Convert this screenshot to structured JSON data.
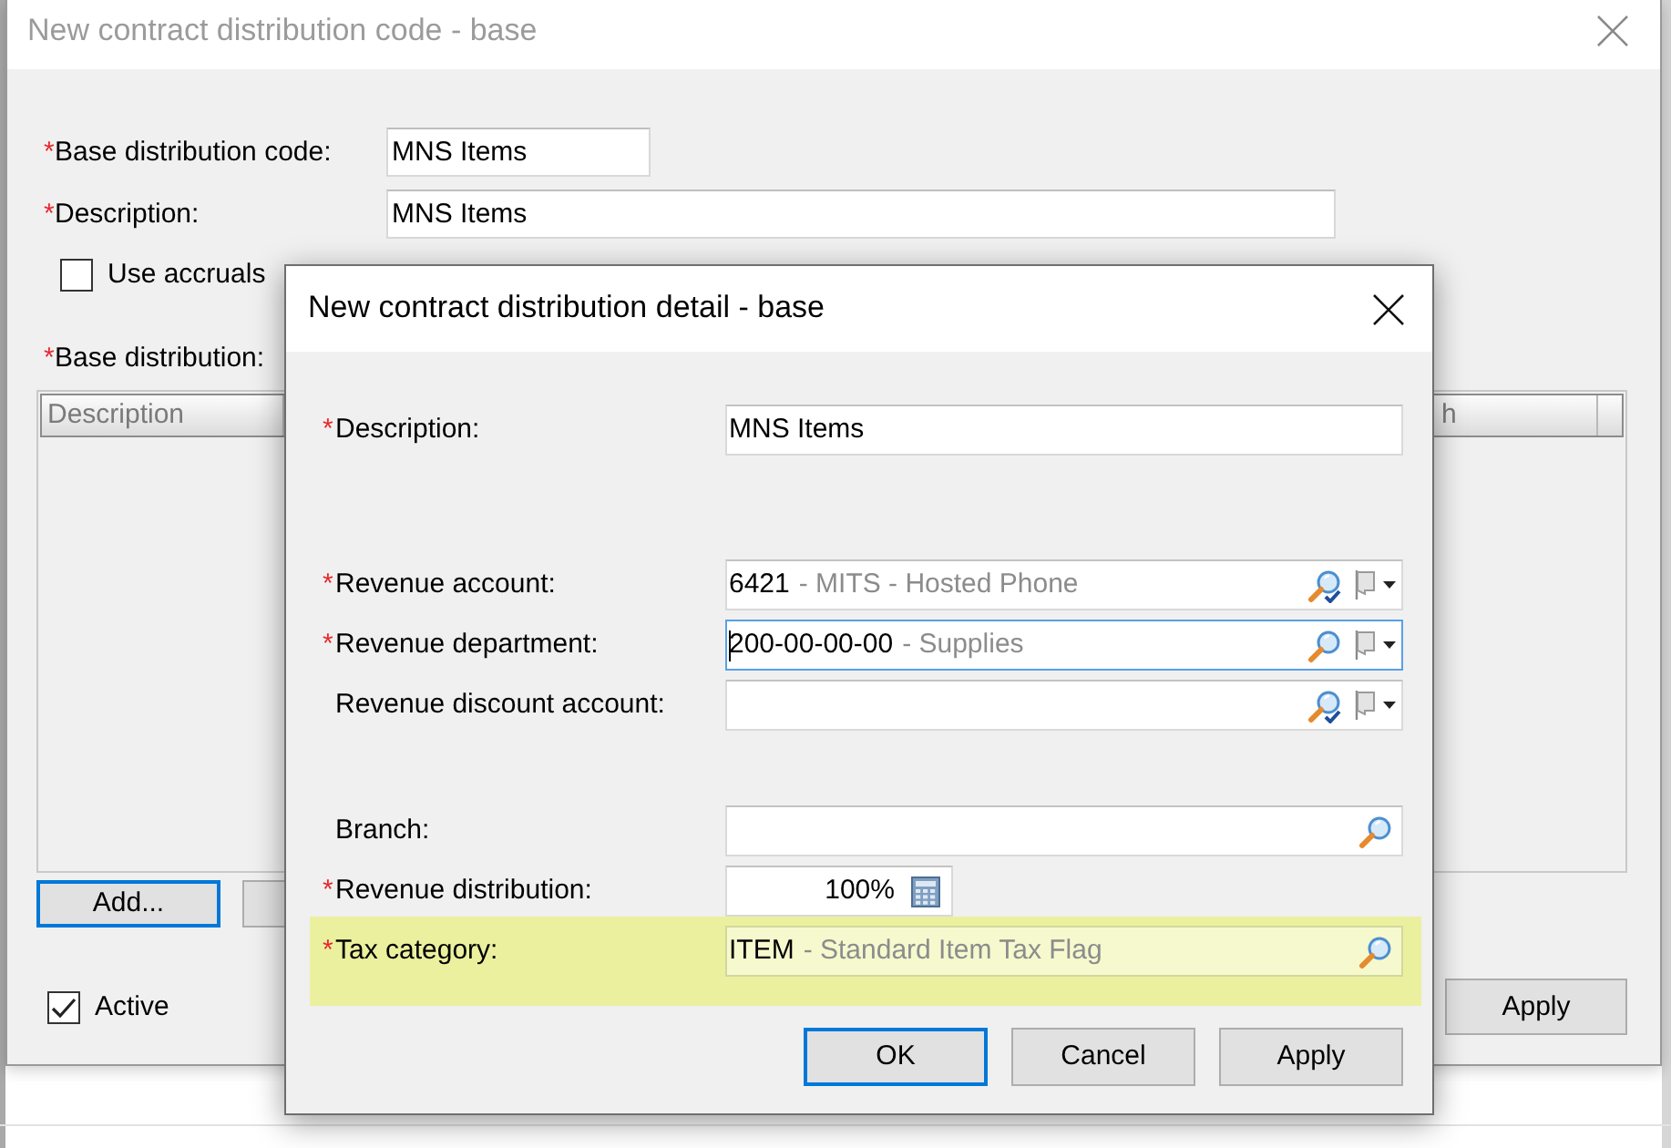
{
  "base_dialog": {
    "title": "New contract distribution code - base",
    "active": false,
    "fields": [
      {
        "kind": "code",
        "required_mark": "*",
        "label": "Base distribution code:",
        "value": "MNS Items"
      },
      {
        "kind": "text",
        "required_mark": "*",
        "label": "Description:",
        "value": "MNS Items"
      }
    ],
    "accruals_checkbox": {
      "label": "Use accruals",
      "checked": false
    },
    "distribution_grid": {
      "required_mark": "*",
      "label": "Base distribution:",
      "columns": [
        "Description",
        "h"
      ]
    },
    "grid_buttons": [
      {
        "label": "Add...",
        "focused": true
      },
      {
        "focused": false
      }
    ],
    "active_checkbox": {
      "label": "Active",
      "checked": true
    },
    "apply_button": {
      "label": "Apply"
    }
  },
  "detail_dialog": {
    "title": "New contract distribution detail - base",
    "active": true,
    "sections": [
      {
        "fields": [
          {
            "kind": "text",
            "required_mark": "*",
            "label": "Description:",
            "value": "MNS Items",
            "focused": false,
            "highlighted": false
          }
        ]
      },
      {
        "fields": [
          {
            "kind": "account",
            "required_mark": "*",
            "label": "Revenue account:",
            "value": "6421",
            "detail": "- MITS - Hosted Phone",
            "focused": false,
            "highlighted": false
          },
          {
            "kind": "segment",
            "required_mark": "*",
            "label": "Revenue department:",
            "value": "200-00-00-00",
            "detail": "- Supplies",
            "focused": true,
            "highlighted": false
          },
          {
            "kind": "account",
            "label": "Revenue discount account:",
            "focused": false,
            "highlighted": false
          }
        ]
      },
      {
        "fields": [
          {
            "kind": "lookup",
            "label": "Branch:",
            "focused": false,
            "highlighted": false
          },
          {
            "kind": "percent",
            "required_mark": "*",
            "label": "Revenue distribution:",
            "value": "100%",
            "focused": false,
            "highlighted": false
          },
          {
            "kind": "lookup",
            "required_mark": "*",
            "label": "Tax category:",
            "value": "ITEM",
            "detail": "- Standard Item Tax Flag",
            "focused": false,
            "highlighted": true
          }
        ]
      }
    ],
    "buttons": [
      {
        "label": "OK",
        "focused": true
      },
      {
        "label": "Cancel",
        "focused": false
      },
      {
        "label": "Apply",
        "focused": false
      }
    ]
  }
}
